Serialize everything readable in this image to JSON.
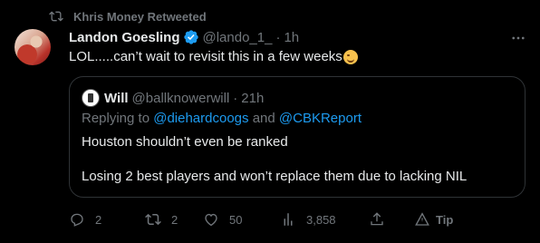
{
  "retweet": {
    "text": "Khris Money Retweeted"
  },
  "tweet": {
    "author_name": "Landon Goesling",
    "author_handle": "@lando_1_",
    "separator": "·",
    "time": "1h",
    "text": "LOL.....can’t wait to revisit this in a few weeks",
    "emoji_icon": "winking-face-emoji",
    "verified_color": "#1d9bf0"
  },
  "quote": {
    "author_name": "Will",
    "author_handle": "@ballknowerwill",
    "separator": "·",
    "time": "21h",
    "reply_prefix": "Replying to",
    "reply_mention_1": "@diehardcoogs",
    "reply_and": "and",
    "reply_mention_2": "@CBKReport",
    "line_1": "Houston shouldn’t even be ranked",
    "line_2": "Losing 2 best players and won’t replace them due to lacking NIL"
  },
  "actions": {
    "replies": "2",
    "retweets": "2",
    "likes": "50",
    "views": "3,858",
    "tip": "Tip"
  },
  "colors": {
    "background": "#000000",
    "text": "#e7e9ea",
    "muted": "#71767b",
    "accent": "#1d9bf0",
    "border": "#2f3336"
  }
}
